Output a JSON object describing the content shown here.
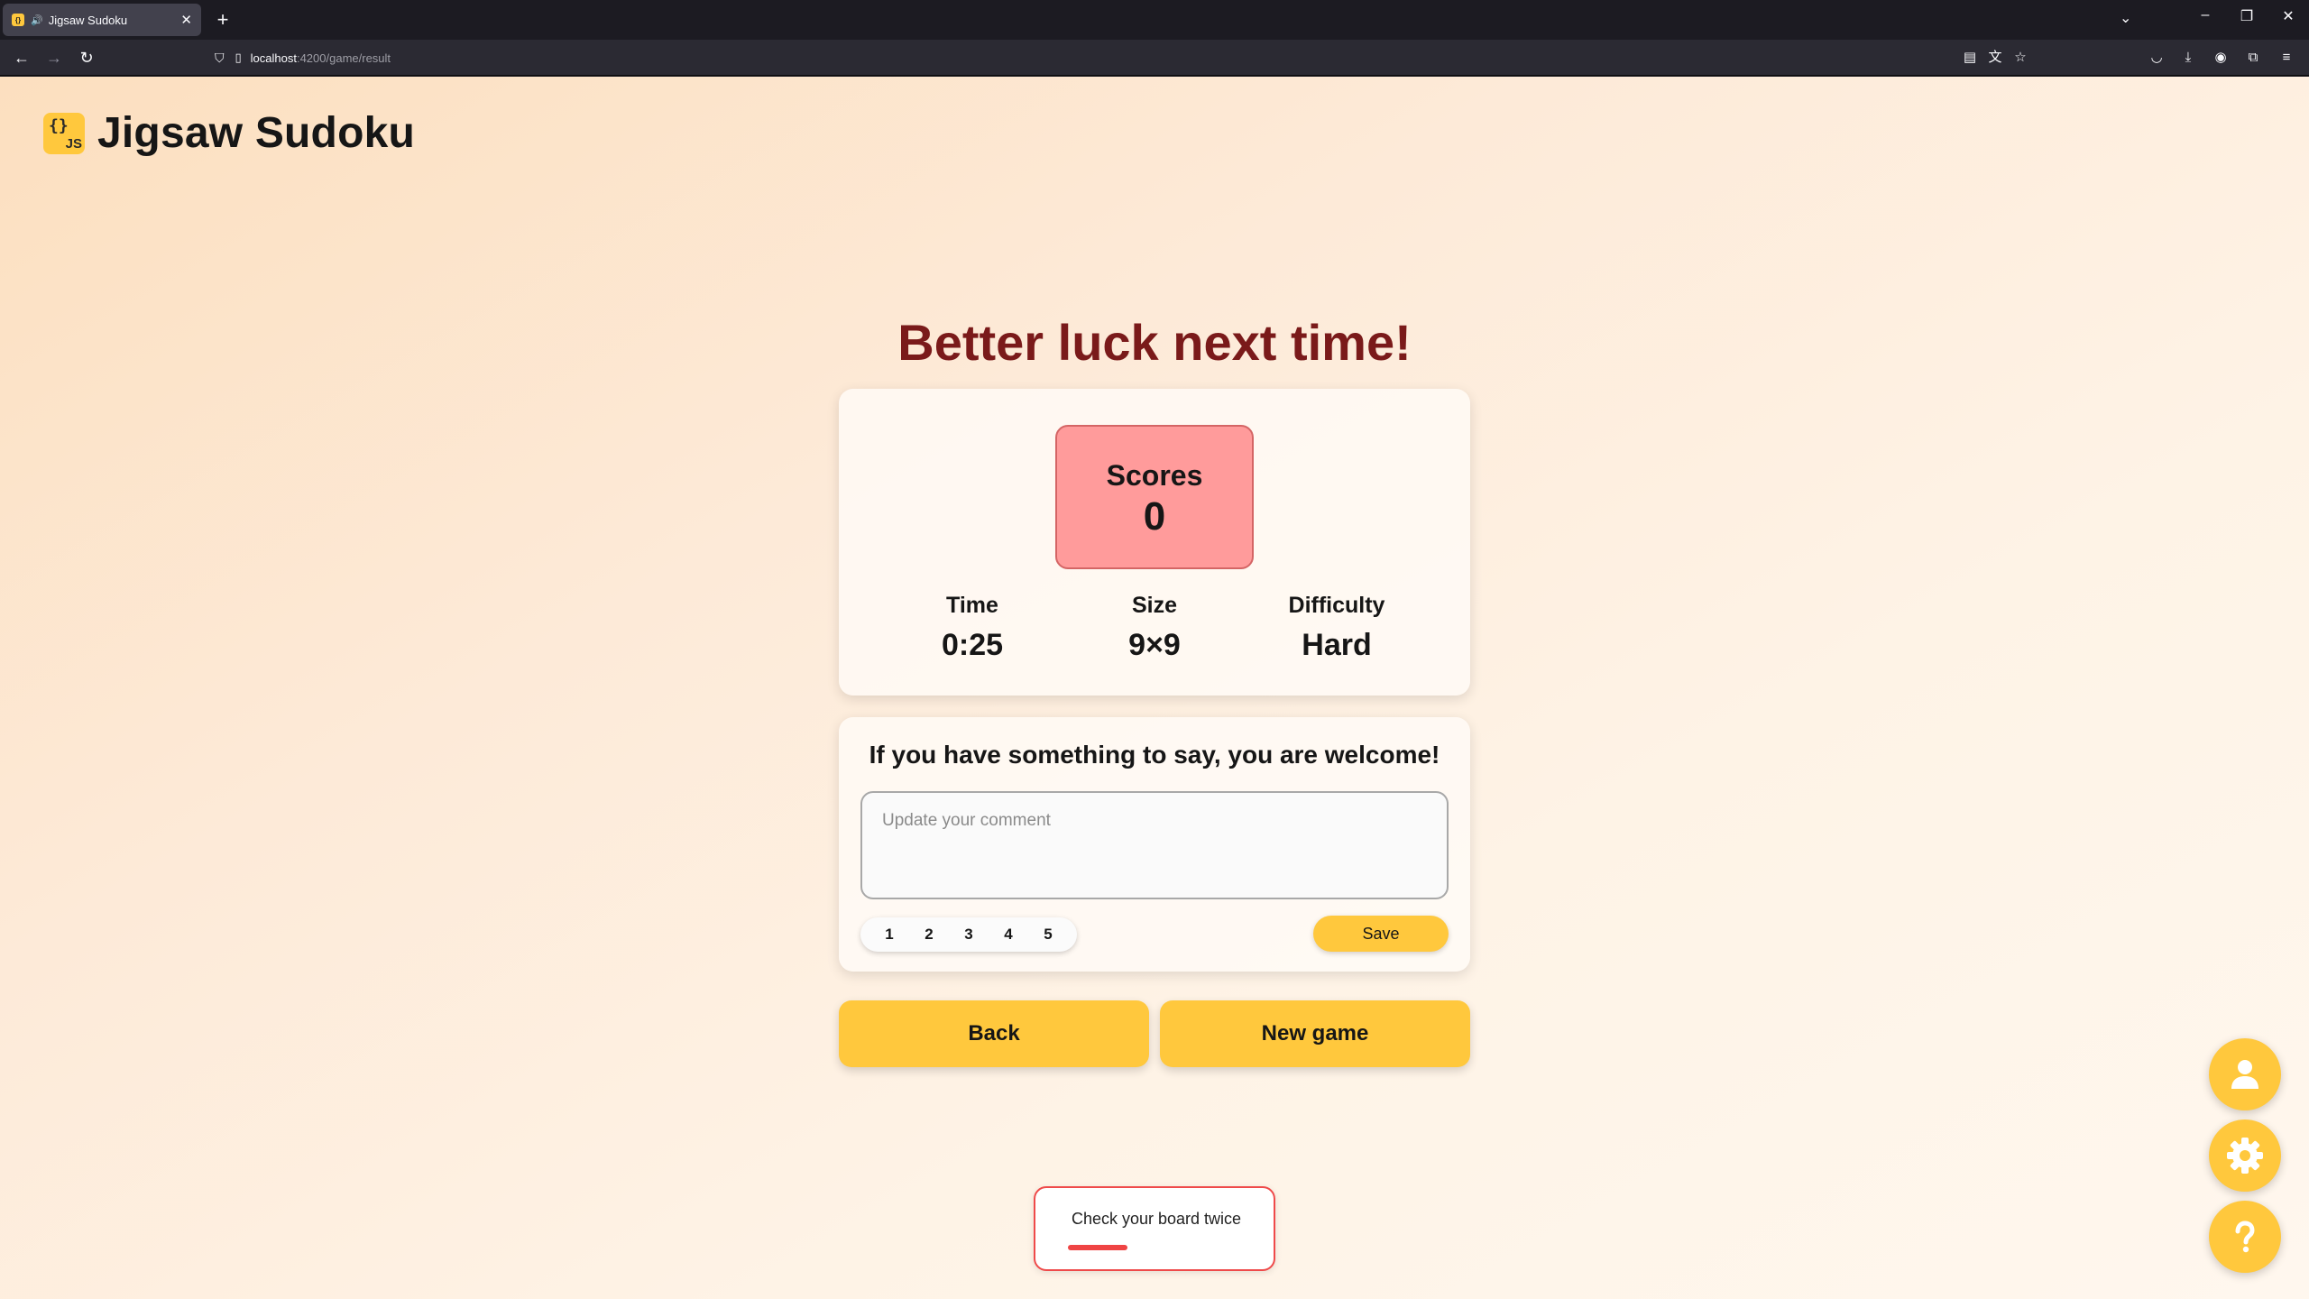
{
  "browser": {
    "tab_title": "Jigsaw Sudoku",
    "url_host": "localhost",
    "url_path": ":4200/game/result"
  },
  "app": {
    "logo_badge": "JS",
    "logo_braces": "{}",
    "title": "Jigsaw Sudoku"
  },
  "result": {
    "heading": "Better luck next time!",
    "score_label": "Scores",
    "score_value": "0",
    "stats": [
      {
        "label": "Time",
        "value": "0:25"
      },
      {
        "label": "Size",
        "value": "9×9"
      },
      {
        "label": "Difficulty",
        "value": "Hard"
      }
    ]
  },
  "comment": {
    "title": "If you have something to say, you are welcome!",
    "placeholder": "Update your comment",
    "ratings": [
      "1",
      "2",
      "3",
      "4",
      "5"
    ],
    "save_label": "Save"
  },
  "actions": {
    "back_label": "Back",
    "new_game_label": "New game"
  },
  "toast": {
    "message": "Check your board twice",
    "progress": 0.3,
    "color": "#ef4444"
  },
  "colors": {
    "accent": "#ffc83d",
    "score_bg": "#ff9b9b",
    "heading": "#7a1a1a"
  },
  "fabs": [
    "user-icon",
    "gear-icon",
    "help-icon"
  ]
}
